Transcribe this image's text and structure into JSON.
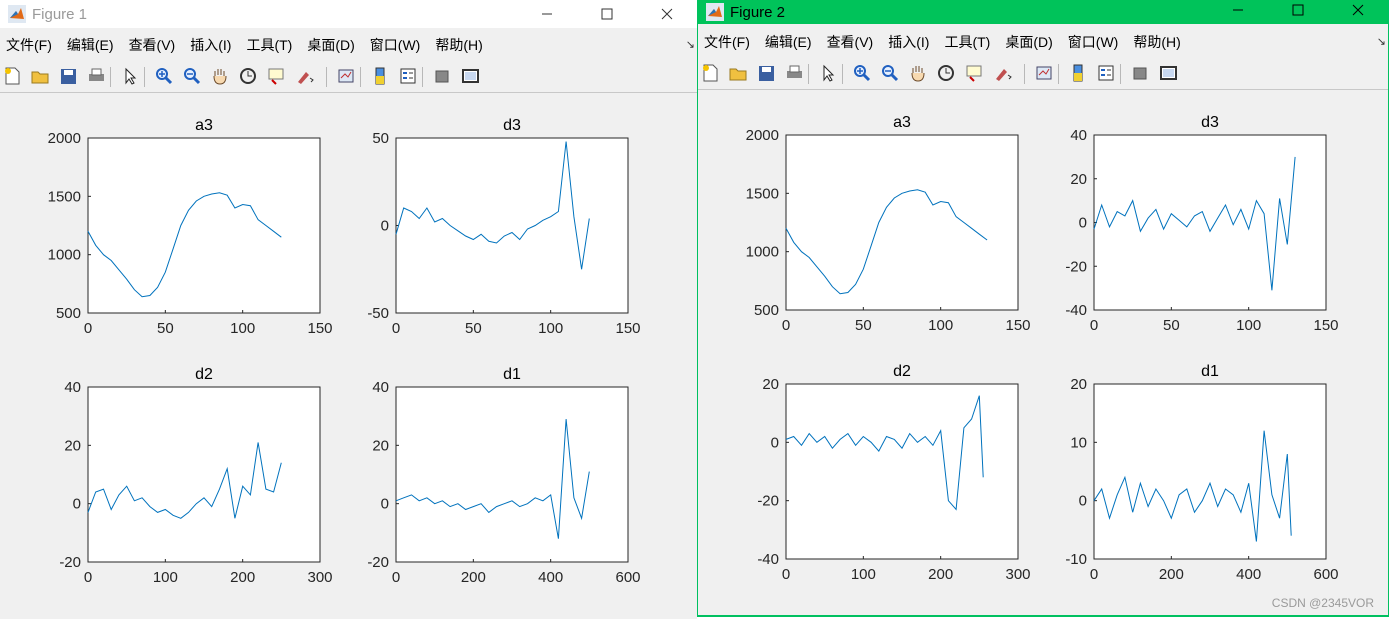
{
  "windows": [
    {
      "id": "win1",
      "title": "Figure 1",
      "menu": [
        "文件(F)",
        "编辑(E)",
        "查看(V)",
        "插入(I)",
        "工具(T)",
        "桌面(D)",
        "窗口(W)",
        "帮助(H)"
      ],
      "toolbar_icons": [
        "new-figure-icon",
        "open-file-icon",
        "save-icon",
        "print-icon",
        "pointer-icon",
        "zoom-in-icon",
        "zoom-out-icon",
        "pan-hand-icon",
        "rotate-3d-icon",
        "data-cursor-icon",
        "brush-icon",
        "link-plot-icon",
        "colorbar-icon",
        "legend-icon",
        "hide-plot-tools-icon",
        "show-plot-tools-icon"
      ]
    },
    {
      "id": "win2",
      "title": "Figure 2",
      "menu": [
        "文件(F)",
        "编辑(E)",
        "查看(V)",
        "插入(I)",
        "工具(T)",
        "桌面(D)",
        "窗口(W)",
        "帮助(H)"
      ],
      "toolbar_icons": [
        "new-figure-icon",
        "open-file-icon",
        "save-icon",
        "print-icon",
        "pointer-icon",
        "zoom-in-icon",
        "zoom-out-icon",
        "pan-hand-icon",
        "rotate-3d-icon",
        "data-cursor-icon",
        "brush-icon",
        "link-plot-icon",
        "colorbar-icon",
        "legend-icon",
        "hide-plot-tools-icon",
        "show-plot-tools-icon"
      ]
    }
  ],
  "watermark": "CSDN @2345VOR",
  "colors": {
    "line": "#0072bd",
    "titlebar_active": "#00c35a",
    "figure_bg": "#f0f0f0"
  },
  "chart_data": [
    {
      "figure": "Figure 1",
      "type": "line",
      "title": "a3",
      "xlim": [
        0,
        150
      ],
      "ylim": [
        500,
        2000
      ],
      "xticks": [
        0,
        50,
        100,
        150
      ],
      "yticks": [
        500,
        1000,
        1500,
        2000
      ],
      "x": [
        0,
        5,
        10,
        15,
        20,
        25,
        30,
        35,
        40,
        45,
        50,
        55,
        60,
        65,
        70,
        75,
        80,
        85,
        90,
        95,
        100,
        105,
        110,
        115,
        120,
        125
      ],
      "y": [
        1200,
        1080,
        1000,
        950,
        870,
        790,
        700,
        640,
        650,
        720,
        850,
        1050,
        1250,
        1380,
        1460,
        1500,
        1520,
        1530,
        1510,
        1400,
        1430,
        1420,
        1300,
        1250,
        1200,
        1150
      ]
    },
    {
      "figure": "Figure 1",
      "type": "line",
      "title": "d3",
      "xlim": [
        0,
        150
      ],
      "ylim": [
        -50,
        50
      ],
      "xticks": [
        0,
        50,
        100,
        150
      ],
      "yticks": [
        -50,
        0,
        50
      ],
      "x": [
        0,
        5,
        10,
        15,
        20,
        25,
        30,
        35,
        40,
        45,
        50,
        55,
        60,
        65,
        70,
        75,
        80,
        85,
        90,
        95,
        100,
        105,
        110,
        115,
        120,
        125
      ],
      "y": [
        -5,
        10,
        8,
        4,
        10,
        2,
        4,
        0,
        -3,
        -6,
        -8,
        -5,
        -9,
        -10,
        -6,
        -4,
        -8,
        -2,
        0,
        3,
        5,
        8,
        48,
        5,
        -25,
        4
      ]
    },
    {
      "figure": "Figure 1",
      "type": "line",
      "title": "d2",
      "xlim": [
        0,
        300
      ],
      "ylim": [
        -20,
        40
      ],
      "xticks": [
        0,
        100,
        200,
        300
      ],
      "yticks": [
        -20,
        0,
        20,
        40
      ],
      "x": [
        0,
        10,
        20,
        30,
        40,
        50,
        60,
        70,
        80,
        90,
        100,
        110,
        120,
        130,
        140,
        150,
        160,
        170,
        180,
        190,
        200,
        210,
        220,
        230,
        240,
        250
      ],
      "y": [
        -3,
        4,
        5,
        -2,
        3,
        6,
        1,
        2,
        -1,
        -3,
        -2,
        -4,
        -5,
        -3,
        0,
        2,
        -1,
        5,
        12,
        -5,
        6,
        3,
        21,
        5,
        4,
        14
      ]
    },
    {
      "figure": "Figure 1",
      "type": "line",
      "title": "d1",
      "xlim": [
        0,
        600
      ],
      "ylim": [
        -20,
        40
      ],
      "xticks": [
        0,
        200,
        400,
        600
      ],
      "yticks": [
        -20,
        0,
        20,
        40
      ],
      "x": [
        0,
        20,
        40,
        60,
        80,
        100,
        120,
        140,
        160,
        180,
        200,
        220,
        240,
        260,
        280,
        300,
        320,
        340,
        360,
        380,
        400,
        420,
        440,
        460,
        480,
        500
      ],
      "y": [
        1,
        2,
        3,
        1,
        2,
        0,
        1,
        -1,
        0,
        -2,
        -1,
        0,
        -3,
        -1,
        0,
        1,
        -1,
        0,
        2,
        1,
        3,
        -12,
        29,
        2,
        -5,
        11
      ]
    },
    {
      "figure": "Figure 2",
      "type": "line",
      "title": "a3",
      "xlim": [
        0,
        150
      ],
      "ylim": [
        500,
        2000
      ],
      "xticks": [
        0,
        50,
        100,
        150
      ],
      "yticks": [
        500,
        1000,
        1500,
        2000
      ],
      "x": [
        0,
        5,
        10,
        15,
        20,
        25,
        30,
        35,
        40,
        45,
        50,
        55,
        60,
        65,
        70,
        75,
        80,
        85,
        90,
        95,
        100,
        105,
        110,
        115,
        120,
        125,
        130
      ],
      "y": [
        1200,
        1080,
        1000,
        950,
        870,
        790,
        700,
        640,
        650,
        720,
        850,
        1050,
        1250,
        1380,
        1460,
        1500,
        1520,
        1530,
        1510,
        1400,
        1430,
        1420,
        1300,
        1250,
        1200,
        1150,
        1100
      ]
    },
    {
      "figure": "Figure 2",
      "type": "line",
      "title": "d3",
      "xlim": [
        0,
        150
      ],
      "ylim": [
        -40,
        40
      ],
      "xticks": [
        0,
        50,
        100,
        150
      ],
      "yticks": [
        -40,
        -20,
        0,
        20,
        40
      ],
      "x": [
        0,
        5,
        10,
        15,
        20,
        25,
        30,
        35,
        40,
        45,
        50,
        55,
        60,
        65,
        70,
        75,
        80,
        85,
        90,
        95,
        100,
        105,
        110,
        115,
        120,
        125,
        130
      ],
      "y": [
        -3,
        8,
        -2,
        5,
        3,
        10,
        -4,
        2,
        6,
        -3,
        4,
        1,
        -2,
        3,
        5,
        -4,
        2,
        8,
        -1,
        6,
        -3,
        10,
        4,
        -31,
        11,
        -10,
        30
      ]
    },
    {
      "figure": "Figure 2",
      "type": "line",
      "title": "d2",
      "xlim": [
        0,
        300
      ],
      "ylim": [
        -40,
        20
      ],
      "xticks": [
        0,
        100,
        200,
        300
      ],
      "yticks": [
        -40,
        -20,
        0,
        20
      ],
      "x": [
        0,
        10,
        20,
        30,
        40,
        50,
        60,
        70,
        80,
        90,
        100,
        110,
        120,
        130,
        140,
        150,
        160,
        170,
        180,
        190,
        200,
        210,
        220,
        230,
        240,
        250,
        255
      ],
      "y": [
        1,
        2,
        -1,
        3,
        0,
        2,
        -2,
        1,
        3,
        -1,
        2,
        0,
        -3,
        2,
        1,
        -2,
        3,
        0,
        2,
        -1,
        4,
        -20,
        -23,
        5,
        8,
        16,
        -12
      ]
    },
    {
      "figure": "Figure 2",
      "type": "line",
      "title": "d1",
      "xlim": [
        0,
        600
      ],
      "ylim": [
        -10,
        20
      ],
      "xticks": [
        0,
        200,
        400,
        600
      ],
      "yticks": [
        -10,
        0,
        10,
        20
      ],
      "x": [
        0,
        20,
        40,
        60,
        80,
        100,
        120,
        140,
        160,
        180,
        200,
        220,
        240,
        260,
        280,
        300,
        320,
        340,
        360,
        380,
        400,
        420,
        440,
        460,
        480,
        500,
        510
      ],
      "y": [
        0,
        2,
        -3,
        1,
        4,
        -2,
        3,
        -1,
        2,
        0,
        -3,
        1,
        2,
        -2,
        0,
        3,
        -1,
        2,
        1,
        -2,
        3,
        -7,
        12,
        1,
        -3,
        8,
        -6
      ]
    }
  ]
}
